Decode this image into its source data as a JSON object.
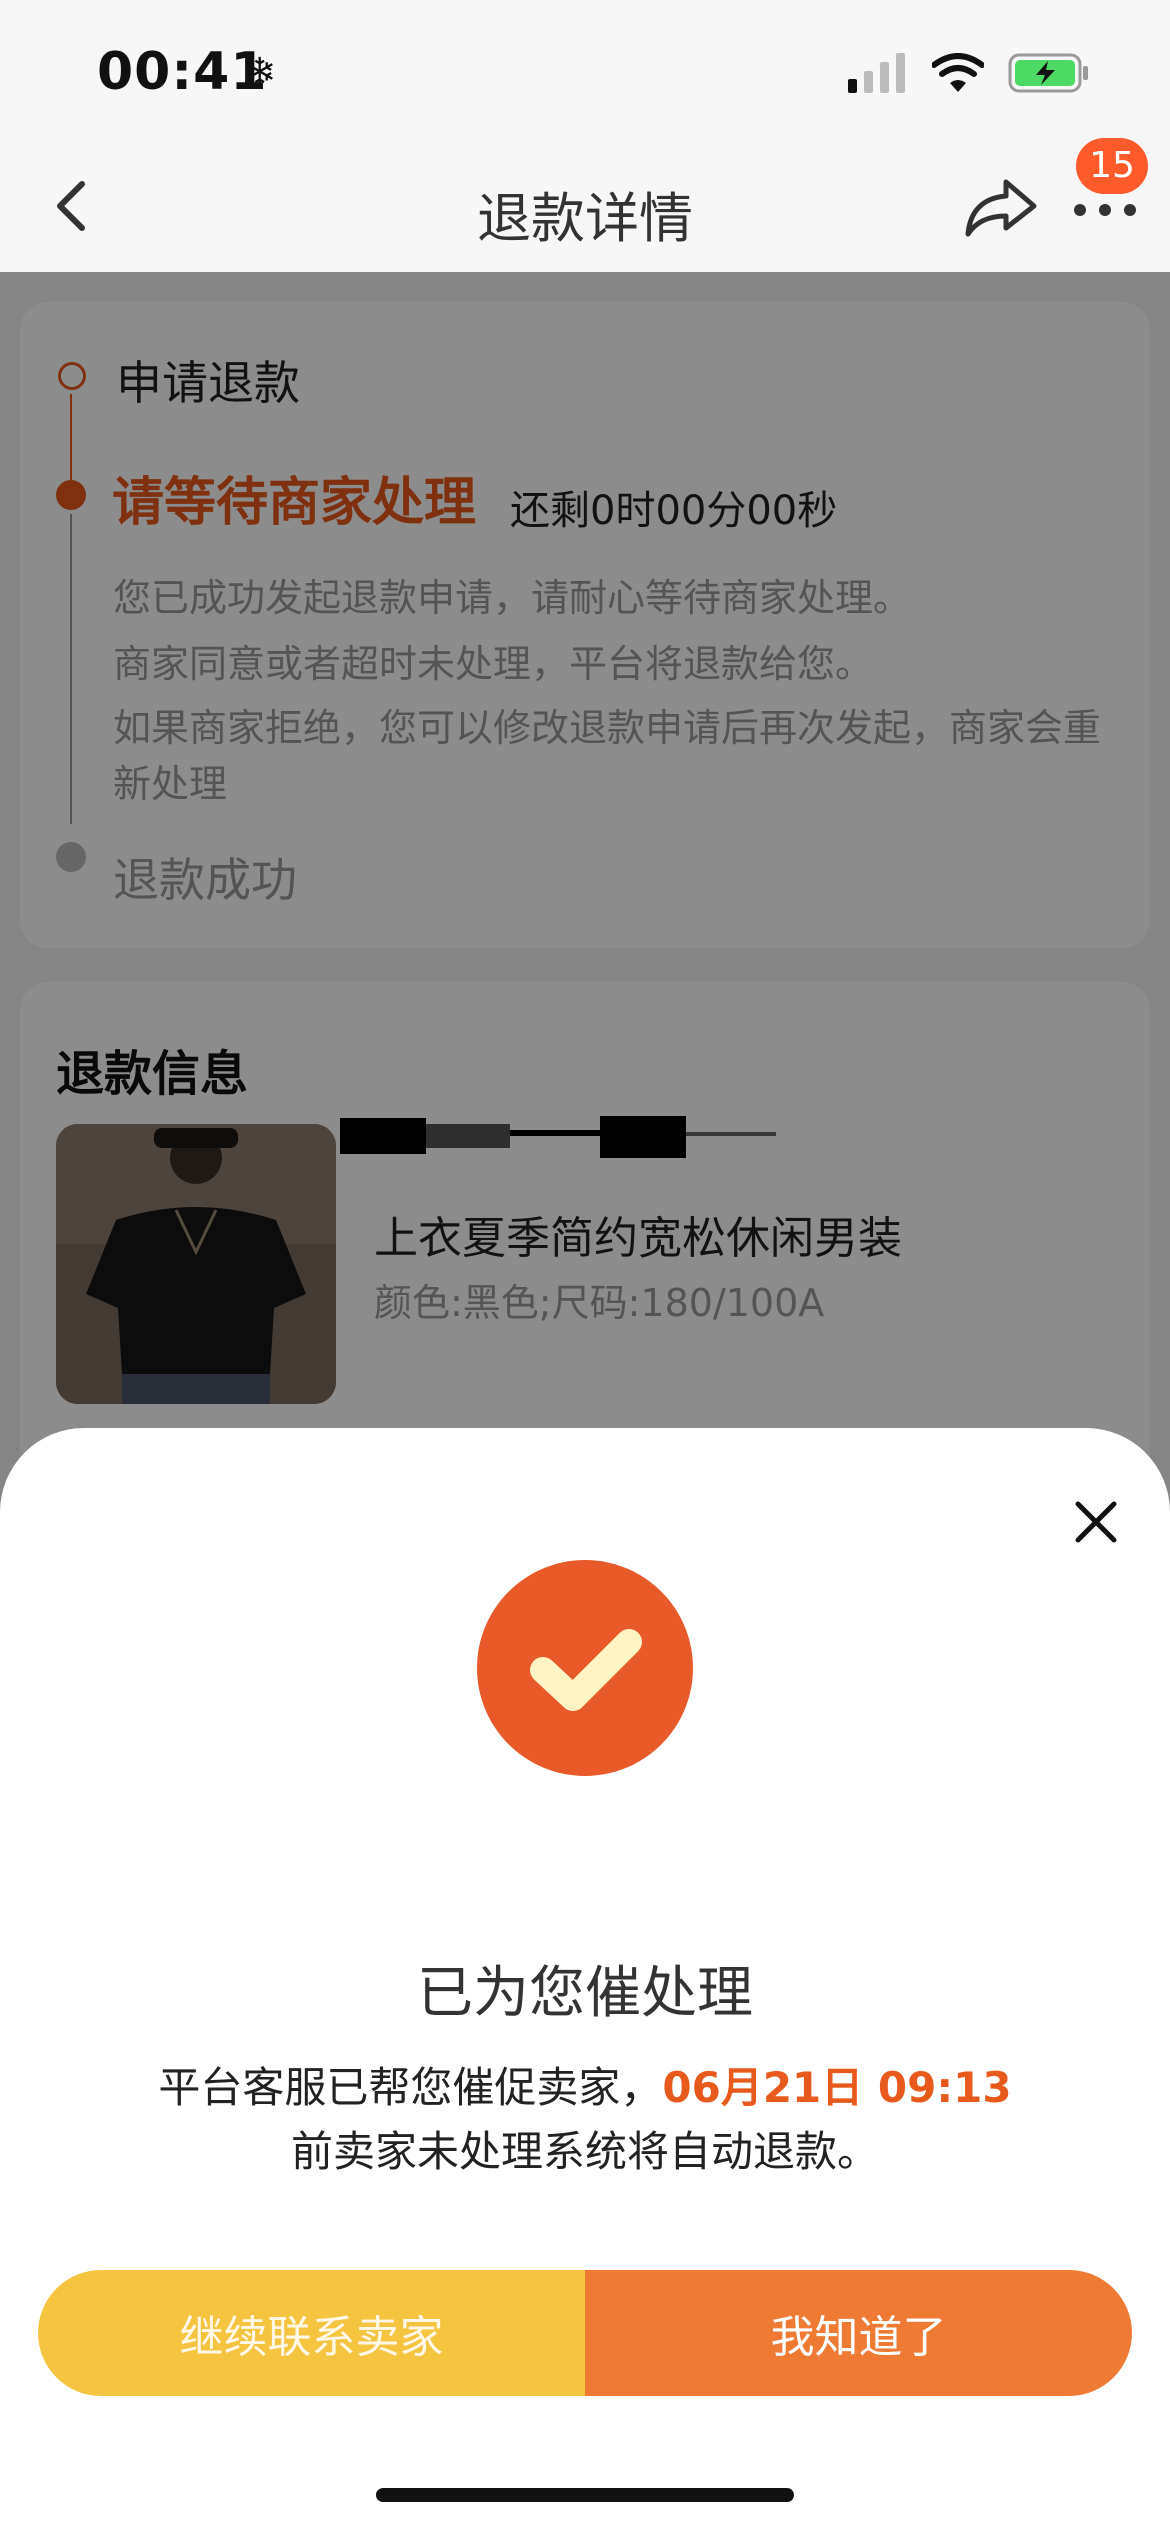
{
  "status_bar": {
    "time": "00:41",
    "time_icon": "snowflake-icon",
    "signal_icon": "signal-icon",
    "wifi_icon": "wifi-icon",
    "battery_icon": "battery-charging-icon"
  },
  "nav": {
    "title": "退款详情",
    "back_icon": "back-icon",
    "share_icon": "share-icon",
    "more_icon": "more-icon",
    "badge_count": "15"
  },
  "progress": {
    "step1": "申请退款",
    "step2": "请等待商家处理",
    "countdown": "还剩0时00分00秒",
    "desc_lines": [
      "您已成功发起退款申请，请耐心等待商家处理。",
      "商家同意或者超时未处理，平台将退款给您。",
      "如果商家拒绝，您可以修改退款申请后再次发起，商家会重新处理"
    ],
    "step3": "退款成功"
  },
  "refund_info": {
    "title": "退款信息",
    "product_name": "上衣夏季简约宽松休闲男装",
    "product_spec": "颜色:黑色;尺码:180/100A"
  },
  "sheet": {
    "close_icon": "close-icon",
    "success_icon": "check-icon",
    "title": "已为您催处理",
    "line1_prefix": "平台客服已帮您催促卖家，",
    "line1_highlight": "06月21日 09:13",
    "line2": "前卖家未处理系统将自动退款。",
    "btn_contact": "继续联系卖家",
    "btn_ok": "我知道了"
  },
  "colors": {
    "accent": "#e85a1c",
    "success_circle": "#e85a2a",
    "btn_contact": "#f5c542",
    "btn_ok": "#ee7a33",
    "badge": "#ff5a2a"
  }
}
